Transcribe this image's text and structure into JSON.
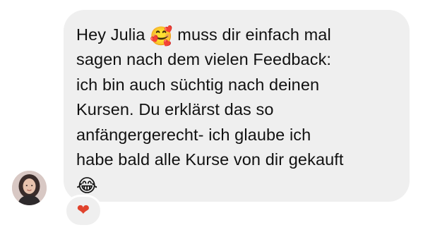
{
  "message": {
    "lines": [
      {
        "before": "Hey Julia ",
        "emoji": "🥰",
        "emoji_name": "smiling-face-with-hearts-icon",
        "after": " muss dir einfach mal"
      },
      {
        "text": "sagen nach dem vielen Feedback:"
      },
      {
        "text": "ich bin auch süchtig nach deinen"
      },
      {
        "text": "Kursen. Du erklärst das so"
      },
      {
        "text": "anfängergerecht- ich glaube ich"
      },
      {
        "text": "habe bald alle Kurse von dir gekauft"
      },
      {
        "emoji": "😂",
        "emoji_name": "face-with-tears-of-joy-icon"
      }
    ]
  },
  "reaction": {
    "emoji": "❤",
    "icon": "heart-icon",
    "color": "#e0432d"
  },
  "colors": {
    "bubble": "#efefef",
    "text": "#111111",
    "background": "#ffffff"
  }
}
